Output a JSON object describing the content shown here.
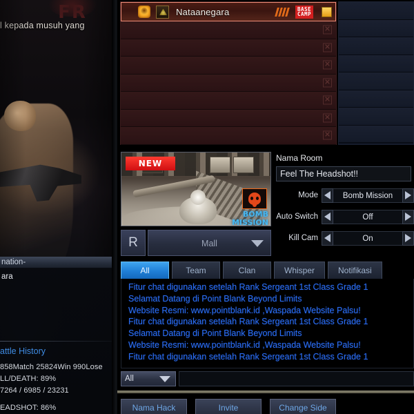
{
  "left_scene": {
    "logo_text": "FR",
    "caption": "l kepada musuh yang"
  },
  "info_panel": {
    "header": "nation-",
    "player_name": "ara",
    "battle_history_title": "attle History",
    "stats": [
      "858Match 25824Win 990Lose",
      "LL/DEATH: 89%",
      "7264 / 6985 / 23231"
    ],
    "headshot": "EADSHOT: 86%"
  },
  "red_team": {
    "leader": {
      "name": "Nataanegara",
      "clan_icon": "clan-emblem-icon",
      "rank_icon": "rank-insignia-icon",
      "rank_bars": 4,
      "badge": "BASE CAMP",
      "ready_icon": "ready-box-icon"
    },
    "empty_slots": 7,
    "slot_close_icon": "close-slot-icon"
  },
  "blue_team": {
    "empty_slots": 8
  },
  "map_preview": {
    "new_badge": "NEW",
    "mode_icon": "skull-icon",
    "mode_label_line1": "BOMB",
    "mode_label_line2": "MISSION"
  },
  "map_select": {
    "random_label": "R",
    "map_name": "Mall",
    "dropdown_icon": "chevron-down-icon"
  },
  "room_settings": {
    "name_label": "Nama Room",
    "room_name_value": "Feel The Headshot!!",
    "rows": [
      {
        "label": "Mode",
        "value": "Bomb Mission"
      },
      {
        "label": "Auto Switch",
        "value": "Off"
      },
      {
        "label": "Kill Cam",
        "value": "On"
      }
    ],
    "prev_icon": "arrow-left-icon",
    "next_icon": "arrow-right-icon"
  },
  "chat": {
    "tabs": [
      {
        "label": "All",
        "active": true
      },
      {
        "label": "Team",
        "active": false
      },
      {
        "label": "Clan",
        "active": false
      },
      {
        "label": "Whisper",
        "active": false
      },
      {
        "label": "Notifikasi",
        "active": false
      }
    ],
    "messages": [
      "Fitur chat digunakan setelah Rank Sergeant 1st Class Grade 1",
      "Selamat Datang di Point Blank Beyond Limits",
      "Website Resmi: www.pointblank.id ,Waspada Website Palsu!",
      "Fitur chat digunakan setelah Rank Sergeant 1st Class Grade 1",
      "Selamat Datang di Point Blank Beyond Limits",
      "Website Resmi: www.pointblank.id ,Waspada Website Palsu!",
      "Fitur chat digunakan setelah Rank Sergeant 1st Class Grade 1"
    ],
    "scope_value": "All",
    "scope_icon": "chevron-down-icon",
    "input_value": ""
  },
  "bottom_buttons": [
    {
      "label": "Nama Hack"
    },
    {
      "label": "Invite"
    },
    {
      "label": "Change Side"
    }
  ],
  "colors": {
    "accent_blue": "#2a6cf0",
    "tab_active": "#1f7fd6",
    "red_panel": "#2b1315",
    "leader_border": "#f08c78",
    "new_badge": "#d21f1f",
    "mode_orange": "#f06a1c"
  }
}
